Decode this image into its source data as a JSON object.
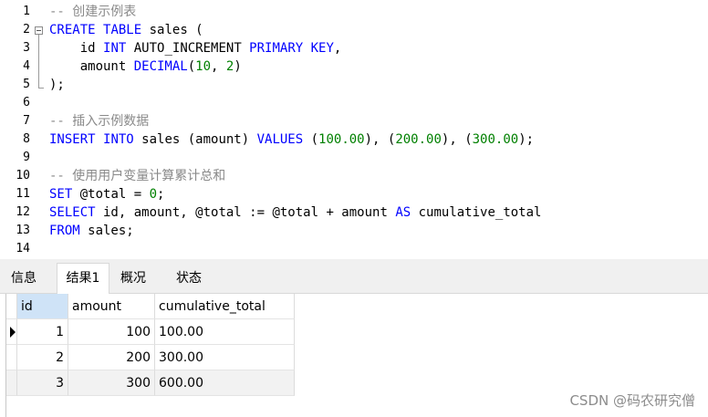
{
  "editor": {
    "lines": [
      {
        "n": "1",
        "segments": [
          [
            "cm",
            "-- 创建示例表"
          ]
        ]
      },
      {
        "n": "2",
        "segments": [
          [
            "kw",
            "CREATE"
          ],
          [
            "id",
            " "
          ],
          [
            "kw",
            "TABLE"
          ],
          [
            "id",
            " sales ("
          ]
        ]
      },
      {
        "n": "3",
        "segments": [
          [
            "id",
            "    id "
          ],
          [
            "kw",
            "INT"
          ],
          [
            "id",
            " AUTO_INCREMENT "
          ],
          [
            "kw",
            "PRIMARY"
          ],
          [
            "id",
            " "
          ],
          [
            "kw",
            "KEY"
          ],
          [
            "id",
            ","
          ]
        ]
      },
      {
        "n": "4",
        "segments": [
          [
            "id",
            "    amount "
          ],
          [
            "kw",
            "DECIMAL"
          ],
          [
            "id",
            "("
          ],
          [
            "num",
            "10"
          ],
          [
            "id",
            ", "
          ],
          [
            "num",
            "2"
          ],
          [
            "id",
            ")"
          ]
        ]
      },
      {
        "n": "5",
        "segments": [
          [
            "id",
            ");"
          ]
        ]
      },
      {
        "n": "6",
        "segments": []
      },
      {
        "n": "7",
        "segments": [
          [
            "cm",
            "-- 插入示例数据"
          ]
        ]
      },
      {
        "n": "8",
        "segments": [
          [
            "kw",
            "INSERT"
          ],
          [
            "id",
            " "
          ],
          [
            "kw",
            "INTO"
          ],
          [
            "id",
            " sales (amount) "
          ],
          [
            "kw",
            "VALUES"
          ],
          [
            "id",
            " ("
          ],
          [
            "num",
            "100.00"
          ],
          [
            "id",
            "), ("
          ],
          [
            "num",
            "200.00"
          ],
          [
            "id",
            "), ("
          ],
          [
            "num",
            "300.00"
          ],
          [
            "id",
            ");"
          ]
        ]
      },
      {
        "n": "9",
        "segments": []
      },
      {
        "n": "10",
        "segments": [
          [
            "cm",
            "-- 使用用户变量计算累计总和"
          ]
        ]
      },
      {
        "n": "11",
        "segments": [
          [
            "kw",
            "SET"
          ],
          [
            "id",
            " @total = "
          ],
          [
            "num",
            "0"
          ],
          [
            "id",
            ";"
          ]
        ]
      },
      {
        "n": "12",
        "segments": [
          [
            "kw",
            "SELECT"
          ],
          [
            "id",
            " id, amount, @total := @total + amount "
          ],
          [
            "kw",
            "AS"
          ],
          [
            "id",
            " cumulative_total"
          ]
        ]
      },
      {
        "n": "13",
        "segments": [
          [
            "kw",
            "FROM"
          ],
          [
            "id",
            " sales;"
          ]
        ]
      },
      {
        "n": "14",
        "segments": []
      }
    ]
  },
  "tabs": [
    {
      "label": "信息",
      "active": false
    },
    {
      "label": "结果1",
      "active": true
    },
    {
      "label": "概况",
      "active": false
    },
    {
      "label": "状态",
      "active": false
    }
  ],
  "result": {
    "columns": [
      "id",
      "amount",
      "cumulative_total"
    ],
    "rows": [
      [
        "1",
        "100",
        "100.00"
      ],
      [
        "2",
        "200",
        "300.00"
      ],
      [
        "3",
        "300",
        "600.00"
      ]
    ]
  },
  "watermark": "CSDN @码农研究僧"
}
